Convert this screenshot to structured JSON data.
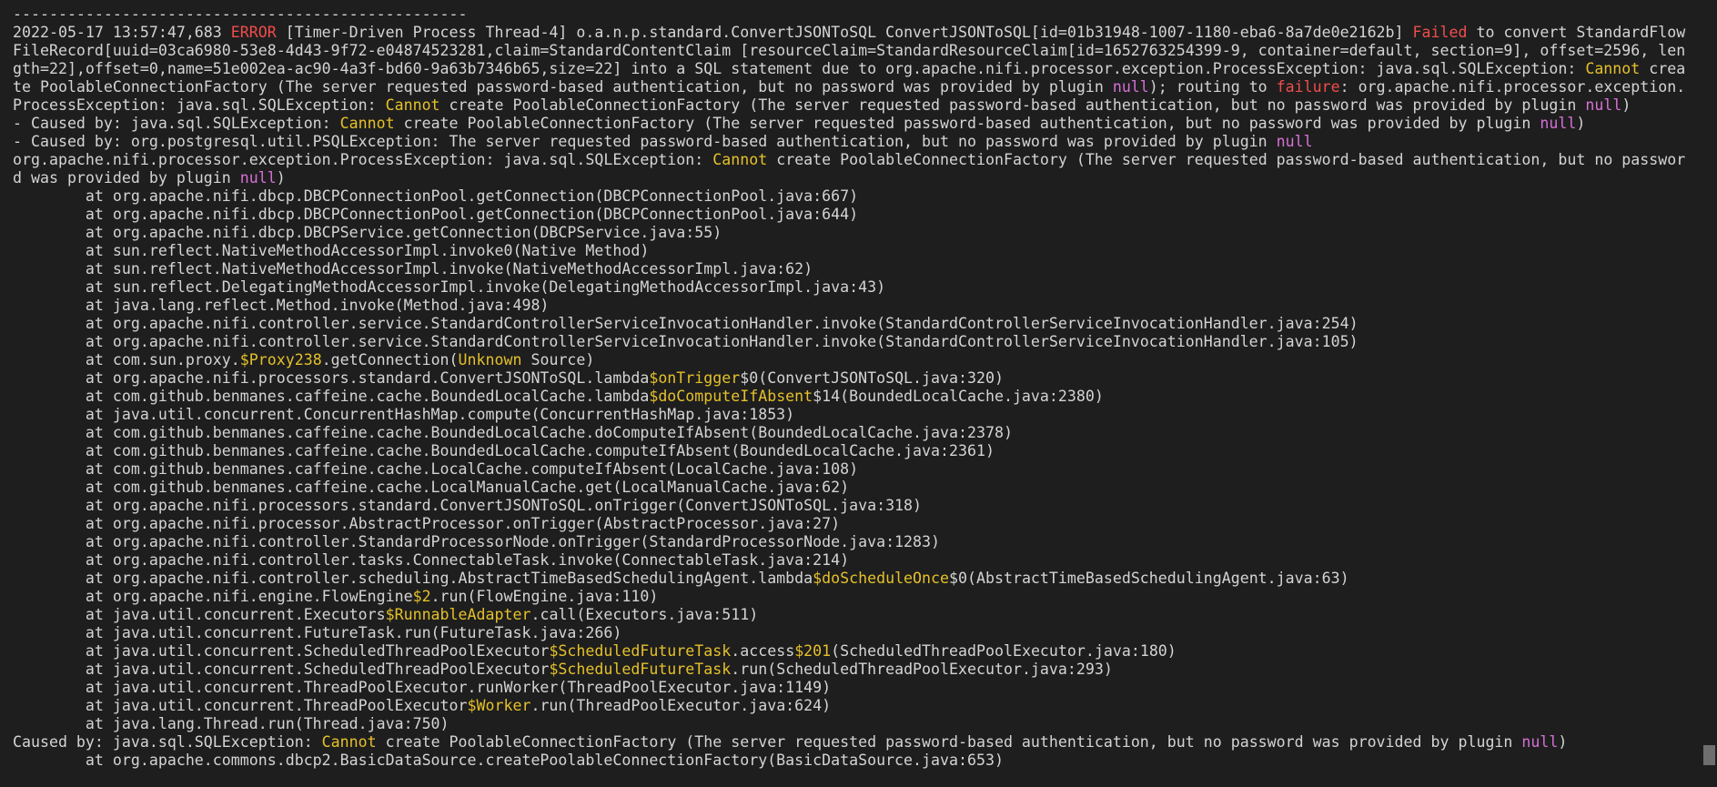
{
  "colors": {
    "background": "#1e1e1e",
    "text": "#d4d4d4",
    "error": "#f14c4c",
    "yellow": "#e5c02a",
    "magenta": "#d670d6"
  },
  "lines": [
    [
      {
        "t": "--------------------------------------------------"
      }
    ],
    [
      {
        "t": "2022-05-17 13:57:47,683 "
      },
      {
        "t": "ERROR",
        "c": "error"
      },
      {
        "t": " [Timer-Driven Process Thread-4] o.a.n.p.standard.ConvertJSONToSQL ConvertJSONToSQL[id=01b31948-1007-1180-eba6-8a7de0e2162b] "
      },
      {
        "t": "Failed",
        "c": "fail"
      },
      {
        "t": " to convert StandardFlow"
      }
    ],
    [
      {
        "t": "FileRecord[uuid=03ca6980-53e8-4d43-9f72-e04874523281,claim=StandardContentClaim [resourceClaim=StandardResourceClaim[id=1652763254399-9, container=default, section=9], offset=2596, len"
      }
    ],
    [
      {
        "t": "gth=22],offset=0,name=51e002ea-ac90-4a3f-bd60-9a63b7346b65,size=22] into a SQL statement due to org.apache.nifi.processor.exception.ProcessException: java.sql.SQLException: "
      },
      {
        "t": "Cannot",
        "c": "yellow"
      },
      {
        "t": " crea"
      }
    ],
    [
      {
        "t": "te PoolableConnectionFactory (The server requested password-based authentication, but no password was provided by plugin "
      },
      {
        "t": "null",
        "c": "magenta"
      },
      {
        "t": "); routing to "
      },
      {
        "t": "failure",
        "c": "fail"
      },
      {
        "t": ": org.apache.nifi.processor.exception."
      }
    ],
    [
      {
        "t": "ProcessException: java.sql.SQLException: "
      },
      {
        "t": "Cannot",
        "c": "yellow"
      },
      {
        "t": " create PoolableConnectionFactory (The server requested password-based authentication, but no password was provided by plugin "
      },
      {
        "t": "null",
        "c": "magenta"
      },
      {
        "t": ")"
      }
    ],
    [
      {
        "t": "- Caused by: java.sql.SQLException: "
      },
      {
        "t": "Cannot",
        "c": "yellow"
      },
      {
        "t": " create PoolableConnectionFactory (The server requested password-based authentication, but no password was provided by plugin "
      },
      {
        "t": "null",
        "c": "magenta"
      },
      {
        "t": ")"
      }
    ],
    [
      {
        "t": "- Caused by: org.postgresql.util.PSQLException: The server requested password-based authentication, but no password was provided by plugin "
      },
      {
        "t": "null",
        "c": "magenta"
      }
    ],
    [
      {
        "t": "org.apache.nifi.processor.exception.ProcessException: java.sql.SQLException: "
      },
      {
        "t": "Cannot",
        "c": "yellow"
      },
      {
        "t": " create PoolableConnectionFactory (The server requested password-based authentication, but no passwor"
      }
    ],
    [
      {
        "t": "d was provided by plugin "
      },
      {
        "t": "null",
        "c": "magenta"
      },
      {
        "t": ")"
      }
    ],
    [
      {
        "t": "        at org.apache.nifi.dbcp.DBCPConnectionPool.getConnection(DBCPConnectionPool.java:667)"
      }
    ],
    [
      {
        "t": "        at org.apache.nifi.dbcp.DBCPConnectionPool.getConnection(DBCPConnectionPool.java:644)"
      }
    ],
    [
      {
        "t": "        at org.apache.nifi.dbcp.DBCPService.getConnection(DBCPService.java:55)"
      }
    ],
    [
      {
        "t": "        at sun.reflect.NativeMethodAccessorImpl.invoke0(Native Method)"
      }
    ],
    [
      {
        "t": "        at sun.reflect.NativeMethodAccessorImpl.invoke(NativeMethodAccessorImpl.java:62)"
      }
    ],
    [
      {
        "t": "        at sun.reflect.DelegatingMethodAccessorImpl.invoke(DelegatingMethodAccessorImpl.java:43)"
      }
    ],
    [
      {
        "t": "        at java.lang.reflect.Method.invoke(Method.java:498)"
      }
    ],
    [
      {
        "t": "        at org.apache.nifi.controller.service.StandardControllerServiceInvocationHandler.invoke(StandardControllerServiceInvocationHandler.java:254)"
      }
    ],
    [
      {
        "t": "        at org.apache.nifi.controller.service.StandardControllerServiceInvocationHandler.invoke(StandardControllerServiceInvocationHandler.java:105)"
      }
    ],
    [
      {
        "t": "        at com.sun.proxy."
      },
      {
        "t": "$Proxy238",
        "c": "yellow"
      },
      {
        "t": ".getConnection("
      },
      {
        "t": "Unknown",
        "c": "yellow"
      },
      {
        "t": " Source)"
      }
    ],
    [
      {
        "t": "        at org.apache.nifi.processors.standard.ConvertJSONToSQL.lambda"
      },
      {
        "t": "$onTrigger",
        "c": "yellow"
      },
      {
        "t": "$0(ConvertJSONToSQL.java:320)"
      }
    ],
    [
      {
        "t": "        at com.github.benmanes.caffeine.cache.BoundedLocalCache.lambda"
      },
      {
        "t": "$doComputeIfAbsent",
        "c": "yellow"
      },
      {
        "t": "$14(BoundedLocalCache.java:2380)"
      }
    ],
    [
      {
        "t": "        at java.util.concurrent.ConcurrentHashMap.compute(ConcurrentHashMap.java:1853)"
      }
    ],
    [
      {
        "t": "        at com.github.benmanes.caffeine.cache.BoundedLocalCache.doComputeIfAbsent(BoundedLocalCache.java:2378)"
      }
    ],
    [
      {
        "t": "        at com.github.benmanes.caffeine.cache.BoundedLocalCache.computeIfAbsent(BoundedLocalCache.java:2361)"
      }
    ],
    [
      {
        "t": "        at com.github.benmanes.caffeine.cache.LocalCache.computeIfAbsent(LocalCache.java:108)"
      }
    ],
    [
      {
        "t": "        at com.github.benmanes.caffeine.cache.LocalManualCache.get(LocalManualCache.java:62)"
      }
    ],
    [
      {
        "t": "        at org.apache.nifi.processors.standard.ConvertJSONToSQL.onTrigger(ConvertJSONToSQL.java:318)"
      }
    ],
    [
      {
        "t": "        at org.apache.nifi.processor.AbstractProcessor.onTrigger(AbstractProcessor.java:27)"
      }
    ],
    [
      {
        "t": "        at org.apache.nifi.controller.StandardProcessorNode.onTrigger(StandardProcessorNode.java:1283)"
      }
    ],
    [
      {
        "t": "        at org.apache.nifi.controller.tasks.ConnectableTask.invoke(ConnectableTask.java:214)"
      }
    ],
    [
      {
        "t": "        at org.apache.nifi.controller.scheduling.AbstractTimeBasedSchedulingAgent.lambda"
      },
      {
        "t": "$doScheduleOnce",
        "c": "yellow"
      },
      {
        "t": "$0(AbstractTimeBasedSchedulingAgent.java:63)"
      }
    ],
    [
      {
        "t": "        at org.apache.nifi.engine.FlowEngine"
      },
      {
        "t": "$2",
        "c": "yellow"
      },
      {
        "t": ".run(FlowEngine.java:110)"
      }
    ],
    [
      {
        "t": "        at java.util.concurrent.Executors"
      },
      {
        "t": "$RunnableAdapter",
        "c": "yellow"
      },
      {
        "t": ".call(Executors.java:511)"
      }
    ],
    [
      {
        "t": "        at java.util.concurrent.FutureTask.run(FutureTask.java:266)"
      }
    ],
    [
      {
        "t": "        at java.util.concurrent.ScheduledThreadPoolExecutor"
      },
      {
        "t": "$ScheduledFutureTask",
        "c": "yellow"
      },
      {
        "t": ".access"
      },
      {
        "t": "$201",
        "c": "yellow"
      },
      {
        "t": "(ScheduledThreadPoolExecutor.java:180)"
      }
    ],
    [
      {
        "t": "        at java.util.concurrent.ScheduledThreadPoolExecutor"
      },
      {
        "t": "$ScheduledFutureTask",
        "c": "yellow"
      },
      {
        "t": ".run(ScheduledThreadPoolExecutor.java:293)"
      }
    ],
    [
      {
        "t": "        at java.util.concurrent.ThreadPoolExecutor.runWorker(ThreadPoolExecutor.java:1149)"
      }
    ],
    [
      {
        "t": "        at java.util.concurrent.ThreadPoolExecutor"
      },
      {
        "t": "$Worker",
        "c": "yellow"
      },
      {
        "t": ".run(ThreadPoolExecutor.java:624)"
      }
    ],
    [
      {
        "t": "        at java.lang.Thread.run(Thread.java:750)"
      }
    ],
    [
      {
        "t": "Caused by: java.sql.SQLException: "
      },
      {
        "t": "Cannot",
        "c": "yellow"
      },
      {
        "t": " create PoolableConnectionFactory (The server requested password-based authentication, but no password was provided by plugin "
      },
      {
        "t": "null",
        "c": "magenta"
      },
      {
        "t": ")"
      }
    ],
    [
      {
        "t": "        at org.apache.commons.dbcp2.BasicDataSource.createPoolableConnectionFactory(BasicDataSource.java:653)"
      }
    ]
  ]
}
